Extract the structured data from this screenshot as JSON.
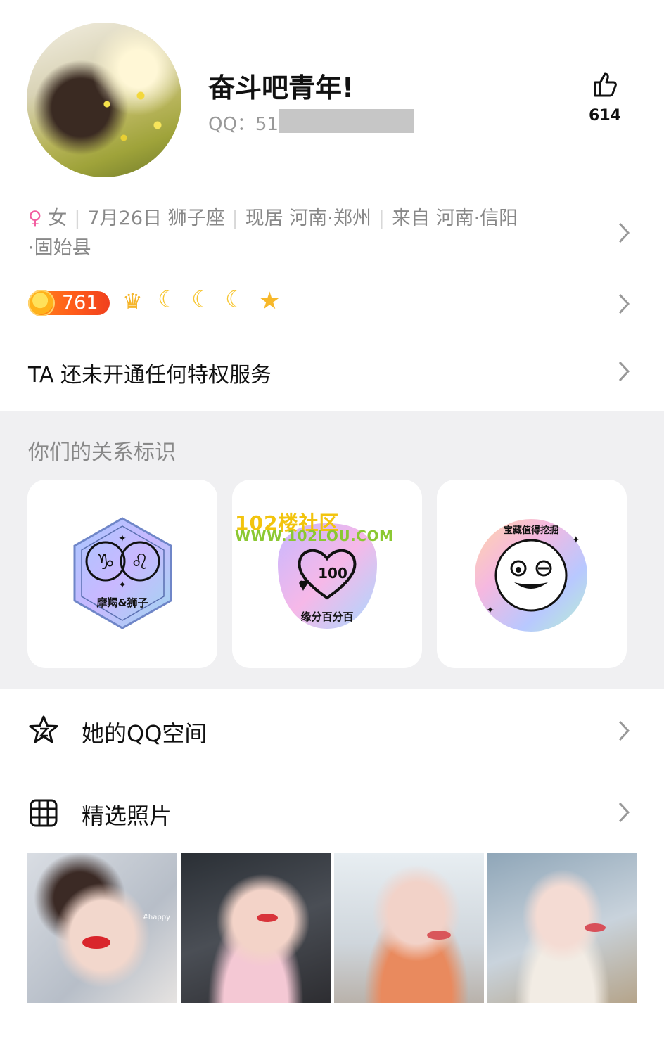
{
  "profile": {
    "nickname": "奋斗吧青年!",
    "qq_label": "QQ：51",
    "likes": "614"
  },
  "info": {
    "gender_symbol": "♀",
    "gender": "女",
    "birthday_sign": "7月26日 狮子座",
    "current_city": "现居 河南·郑州",
    "hometown_a": "来自 河南·信阳",
    "hometown_b": "·固始县"
  },
  "level": {
    "value": "761",
    "icons": [
      "crown-icon",
      "moon-icon",
      "moon-icon",
      "moon-icon",
      "star-icon"
    ]
  },
  "privilege": {
    "text": "TA 还未开通任何特权服务"
  },
  "relations": {
    "title": "你们的关系标识",
    "cards": [
      {
        "icon": "zodiac-badge",
        "label": "摩羯&狮子"
      },
      {
        "icon": "hundred-heart-badge",
        "label": "缘分百分百"
      },
      {
        "icon": "treasure-badge",
        "label": "宝藏值得挖掘"
      }
    ]
  },
  "watermark": {
    "line1": "102楼社区",
    "line2": "WWW.102LOU.COM"
  },
  "qzone": {
    "label": "她的QQ空间"
  },
  "photos": {
    "label": "精选照片",
    "items": [
      "photo-1",
      "photo-2",
      "photo-3",
      "photo-4"
    ],
    "photo1_tag": "#happy"
  },
  "colors": {
    "accent_female": "#f25ea0",
    "level_orange": "#ff5c1a",
    "section_gray": "#f0f0f2"
  }
}
